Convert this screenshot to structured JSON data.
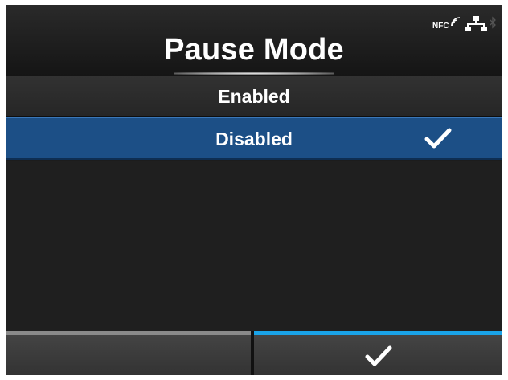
{
  "screen": {
    "title": "Pause Mode"
  },
  "status_bar": {
    "icons": [
      "nfc-icon",
      "lan-icon",
      "bluetooth-icon"
    ],
    "nfc_text": "NFC"
  },
  "options": [
    {
      "label": "Enabled",
      "selected": false
    },
    {
      "label": "Disabled",
      "selected": true
    }
  ],
  "softkeys": {
    "left": {
      "label": ""
    },
    "right": {
      "icon": "checkmark-icon"
    }
  },
  "colors": {
    "selected_row": "#1c4f86",
    "softkey_active_bar": "#1aa3e8",
    "softkey_inactive_bar": "#8a8a8a",
    "background": "#1c1c1c"
  }
}
